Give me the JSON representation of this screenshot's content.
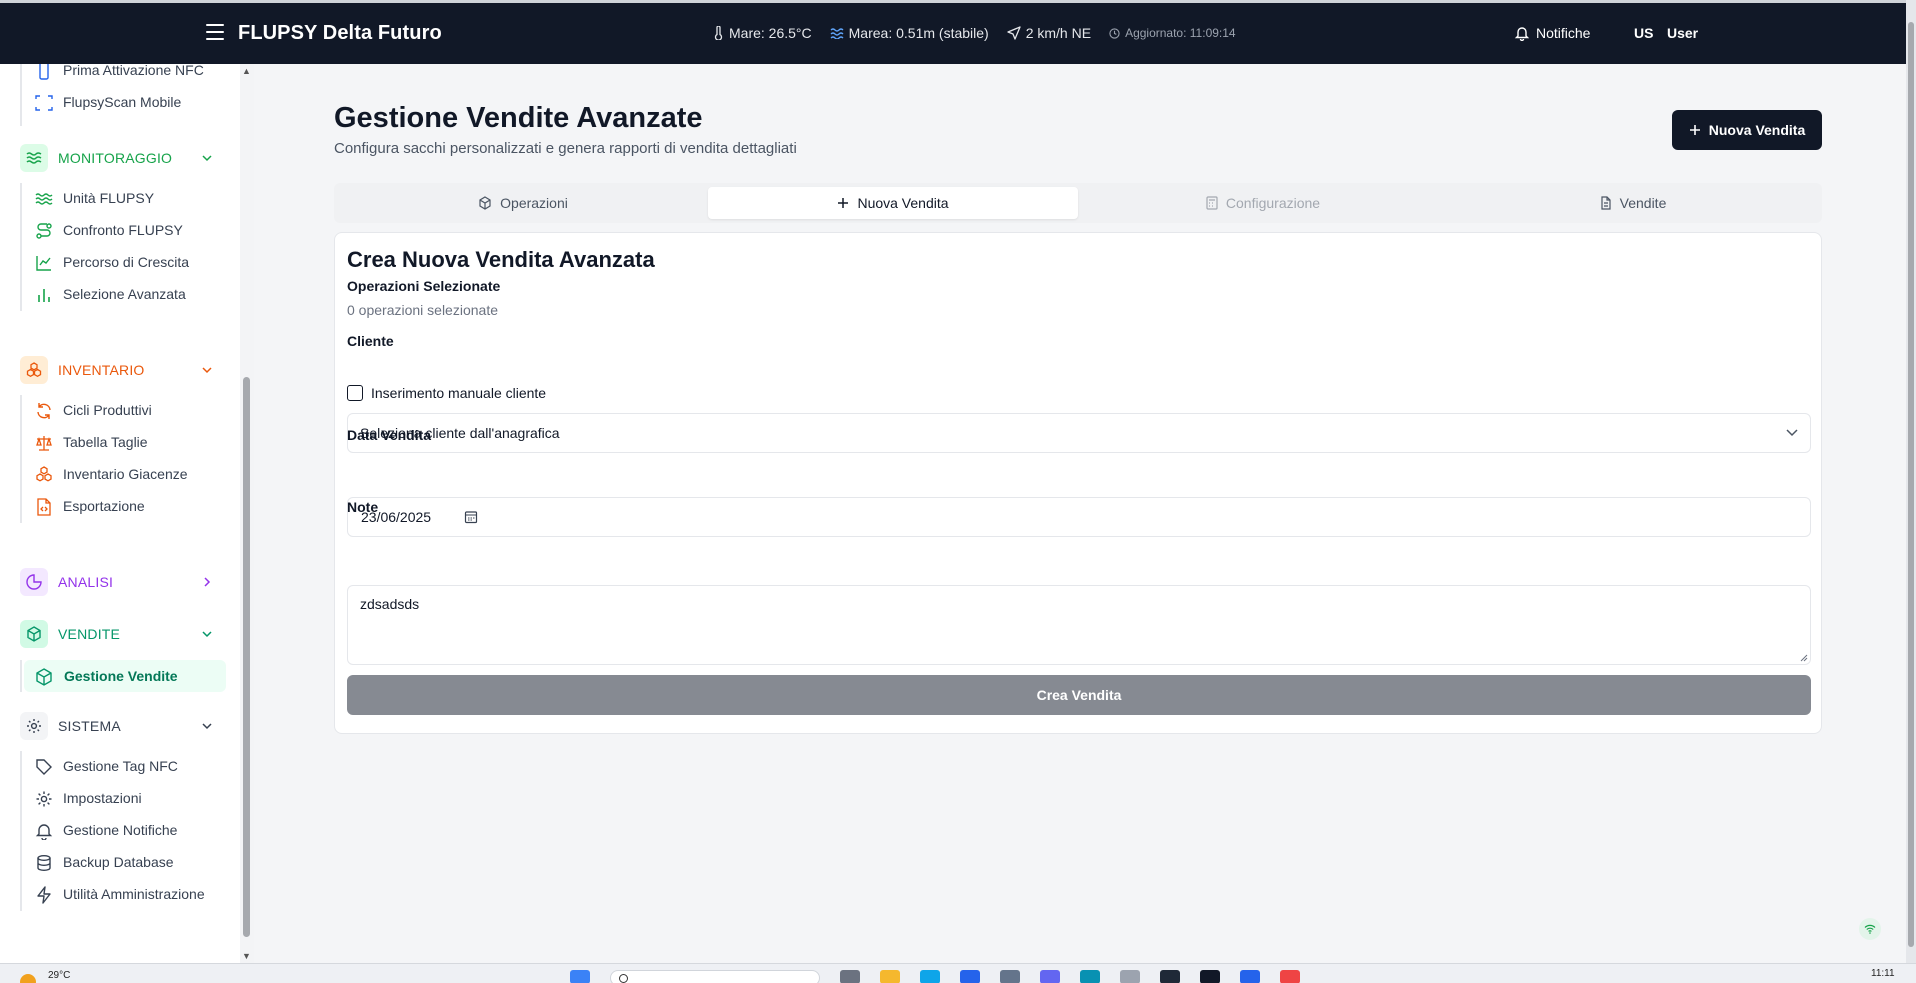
{
  "header": {
    "app_title": "FLUPSY Delta Futuro",
    "weather": {
      "sea_temp": "Mare: 26.5°C",
      "tide": "Marea: 0.51m (stabile)",
      "wind": "2 km/h NE",
      "updated": "Aggiornato: 11:09:14"
    },
    "notifications_label": "Notifiche",
    "user_initials": "US",
    "user_name": "User"
  },
  "sidebar": {
    "top_items": [
      {
        "label": "Prima Attivazione NFC",
        "icon": "smartphone-icon"
      },
      {
        "label": "FlupsyScan Mobile",
        "icon": "scan-icon"
      }
    ],
    "sections": {
      "monitoraggio": {
        "label": "MONITORAGGIO",
        "color": "#16a34a",
        "items": [
          {
            "label": "Unità FLUPSY",
            "icon": "waves-icon"
          },
          {
            "label": "Confronto FLUPSY",
            "icon": "route-icon"
          },
          {
            "label": "Percorso di Crescita",
            "icon": "line-chart-icon"
          },
          {
            "label": "Selezione Avanzata",
            "icon": "bar-chart-icon"
          }
        ]
      },
      "inventario": {
        "label": "INVENTARIO",
        "color": "#ea580c",
        "items": [
          {
            "label": "Cicli Produttivi",
            "icon": "refresh-icon"
          },
          {
            "label": "Tabella Taglie",
            "icon": "scale-icon"
          },
          {
            "label": "Inventario Giacenze",
            "icon": "boxes-icon"
          },
          {
            "label": "Esportazione",
            "icon": "file-code-icon"
          }
        ]
      },
      "analisi": {
        "label": "ANALISI",
        "color": "#9333ea"
      },
      "vendite": {
        "label": "VENDITE",
        "color": "#059669",
        "items": [
          {
            "label": "Gestione Vendite",
            "icon": "package-icon"
          }
        ]
      },
      "sistema": {
        "label": "SISTEMA",
        "color": "#374151",
        "items": [
          {
            "label": "Gestione Tag NFC",
            "icon": "tag-icon"
          },
          {
            "label": "Impostazioni",
            "icon": "gear-icon"
          },
          {
            "label": "Gestione Notifiche",
            "icon": "bell-icon"
          },
          {
            "label": "Backup Database",
            "icon": "database-icon"
          },
          {
            "label": "Utilità Amministrazione",
            "icon": "zap-icon"
          }
        ]
      }
    }
  },
  "main": {
    "title": "Gestione Vendite Avanzate",
    "subtitle": "Configura sacchi personalizzati e genera rapporti di vendita dettagliati",
    "new_sale_button": "Nuova Vendita",
    "tabs": [
      {
        "label": "Operazioni",
        "icon": "package-icon",
        "state": "normal"
      },
      {
        "label": "Nuova Vendita",
        "icon": "plus-icon",
        "state": "active"
      },
      {
        "label": "Configurazione",
        "icon": "calculator-icon",
        "state": "disabled"
      },
      {
        "label": "Vendite",
        "icon": "file-text-icon",
        "state": "normal"
      }
    ],
    "form": {
      "title": "Crea Nuova Vendita Avanzata",
      "selected_ops_label": "Operazioni Selezionate",
      "selected_ops_value": "0 operazioni selezionate",
      "client_label": "Cliente",
      "manual_client_label": "Inserimento manuale cliente",
      "client_select_value": "Seleziona cliente dall'anagrafica",
      "date_label": "Data Vendita",
      "date_value": "23/06/2025",
      "notes_label": "Note",
      "notes_value": "zdsadsds",
      "submit_label": "Crea Vendita"
    }
  },
  "taskbar": {
    "temperature": "29°C",
    "clock": "11:11"
  }
}
